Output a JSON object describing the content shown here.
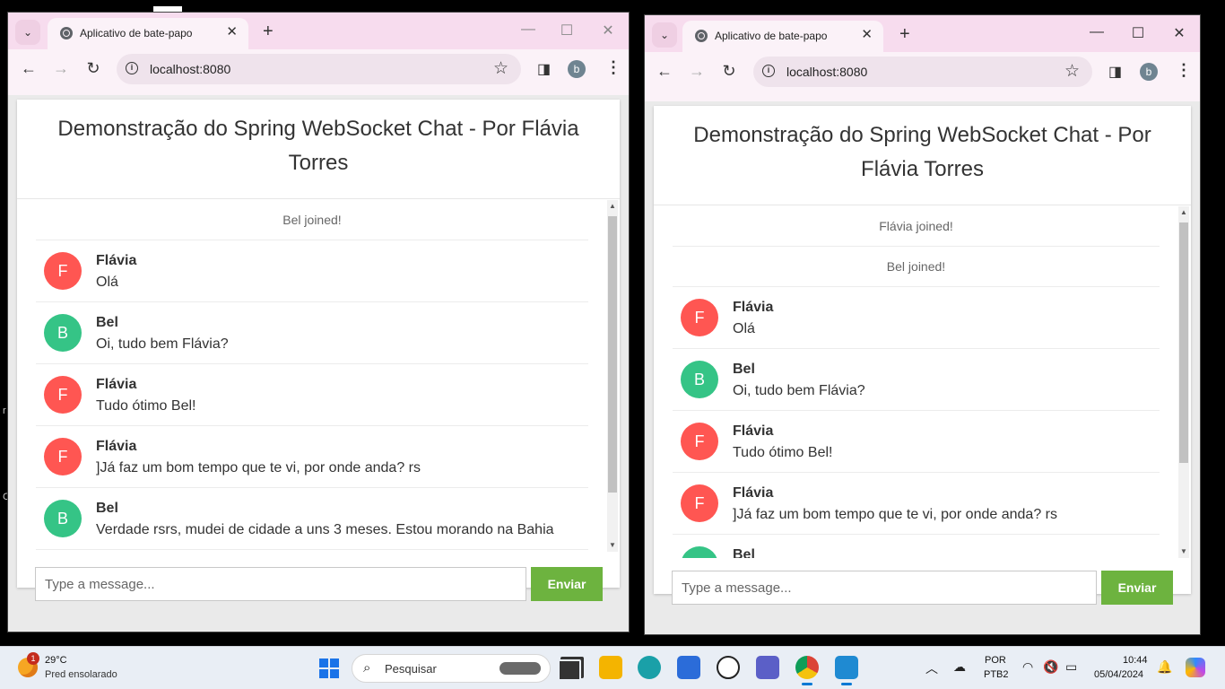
{
  "browser": {
    "tab_title": "Aplicativo de bate-papo",
    "url": "localhost:8080",
    "profile_initial": "b",
    "new_tab_symbol": "+"
  },
  "chat": {
    "header_title": "Demonstração do Spring WebSocket Chat - Por Flávia Torres",
    "input_placeholder": "Type a message...",
    "send_label": "Enviar",
    "colors": {
      "flavia_avatar": "#ff5652",
      "bel_avatar": "#35c486",
      "send_button": "#6db33f"
    }
  },
  "left_window": {
    "messages": [
      {
        "type": "event",
        "text": "Bel joined!"
      },
      {
        "type": "chat",
        "sender": "Flávia",
        "initial": "F",
        "text": "Olá",
        "avatar_color": "#ff5652"
      },
      {
        "type": "chat",
        "sender": "Bel",
        "initial": "B",
        "text": "Oi, tudo bem Flávia?",
        "avatar_color": "#35c486"
      },
      {
        "type": "chat",
        "sender": "Flávia",
        "initial": "F",
        "text": "Tudo ótimo Bel!",
        "avatar_color": "#ff5652"
      },
      {
        "type": "chat",
        "sender": "Flávia",
        "initial": "F",
        "text": "]Já faz um bom tempo que te vi, por onde anda? rs",
        "avatar_color": "#ff5652"
      },
      {
        "type": "chat",
        "sender": "Bel",
        "initial": "B",
        "text": "Verdade rsrs, mudei de cidade a uns 3 meses. Estou morando na Bahia",
        "avatar_color": "#35c486"
      }
    ]
  },
  "right_window": {
    "messages": [
      {
        "type": "event",
        "text": "Flávia joined!"
      },
      {
        "type": "event",
        "text": "Bel joined!"
      },
      {
        "type": "chat",
        "sender": "Flávia",
        "initial": "F",
        "text": "Olá",
        "avatar_color": "#ff5652"
      },
      {
        "type": "chat",
        "sender": "Bel",
        "initial": "B",
        "text": "Oi, tudo bem Flávia?",
        "avatar_color": "#35c486"
      },
      {
        "type": "chat",
        "sender": "Flávia",
        "initial": "F",
        "text": "Tudo ótimo Bel!",
        "avatar_color": "#ff5652"
      },
      {
        "type": "chat",
        "sender": "Flávia",
        "initial": "F",
        "text": "]Já faz um bom tempo que te vi, por onde anda? rs",
        "avatar_color": "#ff5652"
      },
      {
        "type": "chat",
        "sender": "Bel",
        "initial": "B",
        "text": "",
        "avatar_color": "#35c486"
      }
    ]
  },
  "taskbar": {
    "weather_temp": "29°C",
    "weather_desc": "Pred ensolarado",
    "weather_badge": "1",
    "search_placeholder": "Pesquisar",
    "language": "POR",
    "layout": "PTB2",
    "time": "10:44",
    "date": "05/04/2024",
    "apps": [
      "file-explorer",
      "files",
      "edge",
      "store",
      "dell",
      "teams",
      "chrome",
      "vscode"
    ]
  }
}
